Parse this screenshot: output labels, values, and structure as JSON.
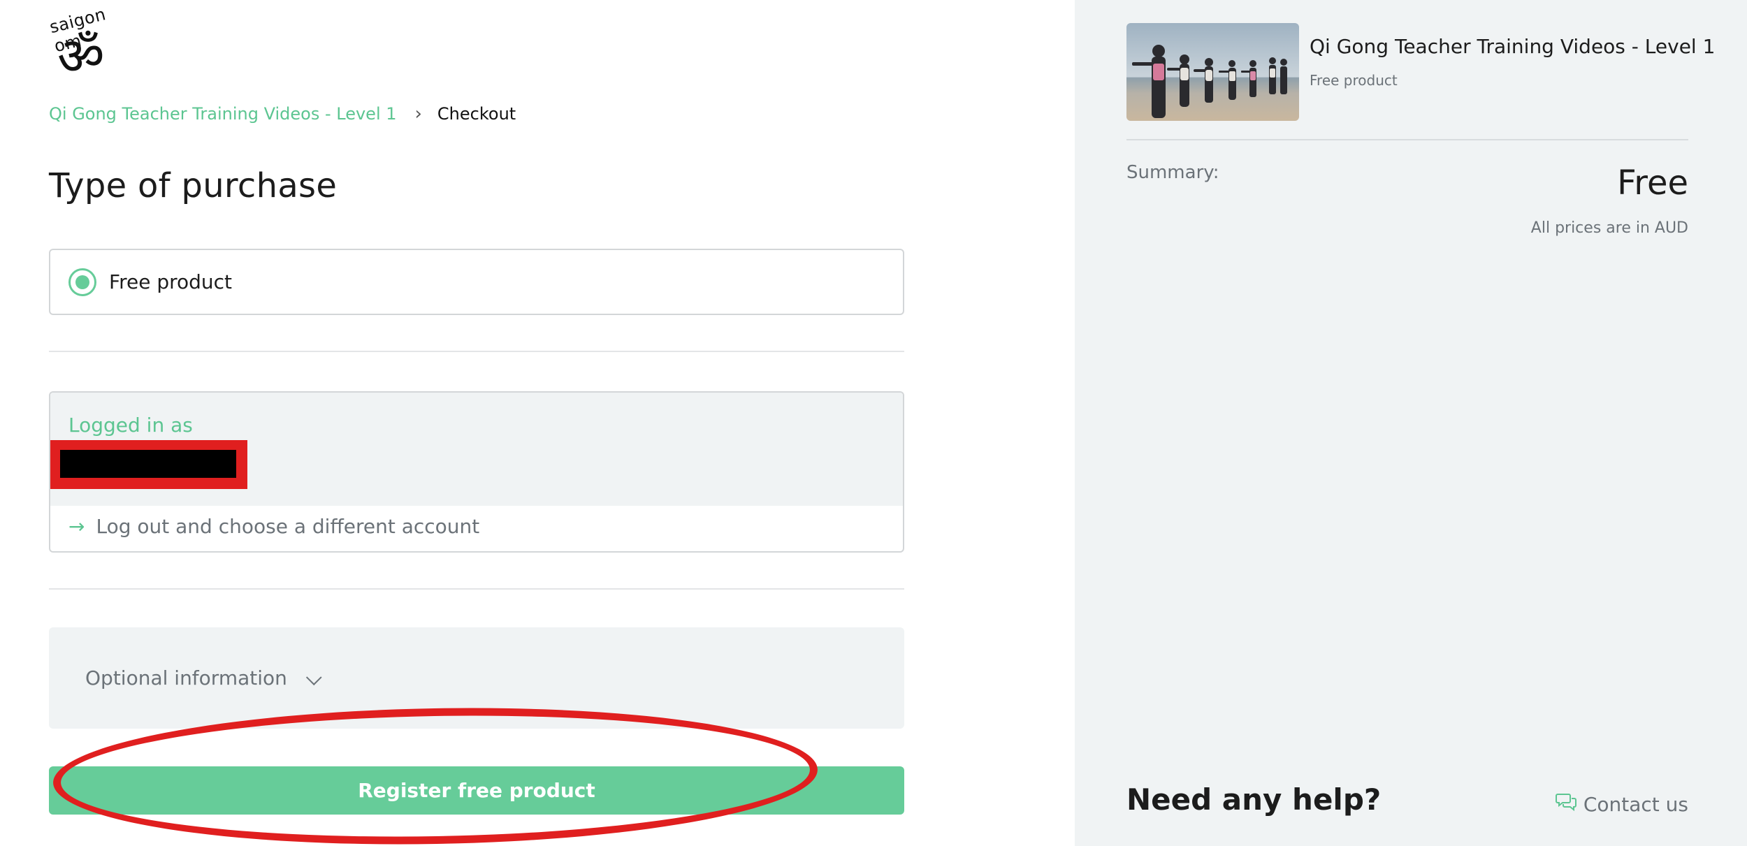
{
  "brand": {
    "logo_text": "saigon om",
    "logo_glyph": "ॐ"
  },
  "breadcrumb": {
    "product_link": "Qi Gong Teacher Training Videos - Level 1",
    "separator": "›",
    "current": "Checkout"
  },
  "purchase": {
    "title": "Type of purchase",
    "option_label": "Free product",
    "selected": true
  },
  "account": {
    "logged_in_label": "Logged in as",
    "logout_arrow": "→",
    "logout_label": "Log out and choose a different account"
  },
  "optional": {
    "label": "Optional information"
  },
  "actions": {
    "register_label": "Register free product"
  },
  "sidebar": {
    "product_name": "Qi Gong Teacher Training Videos - Level 1",
    "product_type": "Free product",
    "summary_label": "Summary:",
    "summary_price": "Free",
    "currency_note": "All prices are in AUD",
    "help_heading": "Need any help?",
    "contact_label": "Contact us"
  },
  "colors": {
    "accent": "#66cc99",
    "link": "#5cc591",
    "annotation": "#e01f1f",
    "sidebar_bg": "#f0f3f4"
  },
  "icons": [
    "om-logo-icon",
    "chevron-right-icon",
    "radio-selected-icon",
    "arrow-right-icon",
    "chevron-down-icon",
    "chat-bubble-icon"
  ]
}
